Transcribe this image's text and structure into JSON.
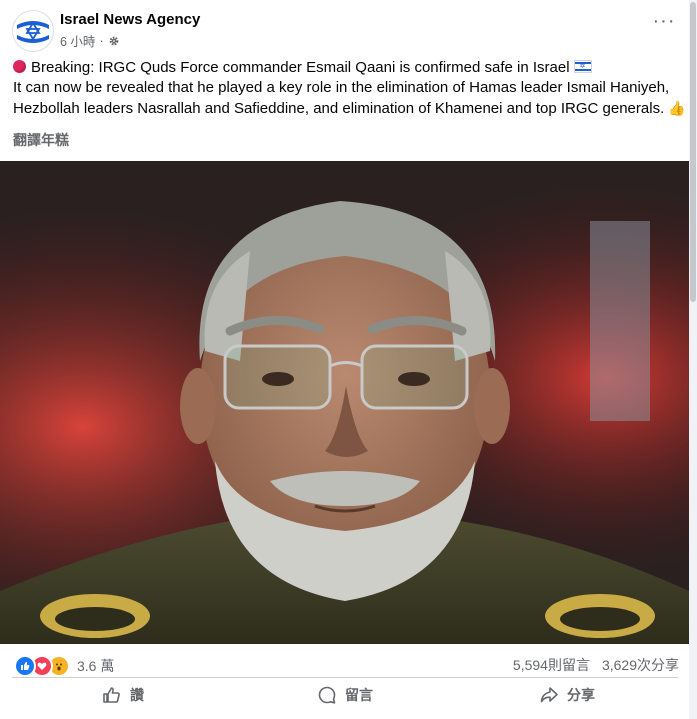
{
  "post": {
    "page_name": "Israel News Agency",
    "time": "6 小時",
    "line1": "Breaking: IRGC Quds Force commander Esmail Qaani is confirmed safe in Israel",
    "line2": "It can now be revealed that he played a key role in the elimination of Hamas leader Ismail Haniyeh,",
    "line3": "Hezbollah leaders Nasrallah and Safieddine, and elimination of Khamenei and top IRGC generals.",
    "translate_label": "翻譯年糕"
  },
  "engagement": {
    "reaction_count": "3.6 萬",
    "comments": "5,594則留言",
    "shares": "3,629次分享"
  },
  "actions": {
    "like": "讚",
    "comment": "留言",
    "share": "分享"
  },
  "icons": {
    "privacy": "settings-gear-icon",
    "more": "more-dots-icon",
    "reactions": [
      "like-icon",
      "love-icon",
      "wow-icon"
    ]
  },
  "colors": {
    "brand_blue": "#1877f2",
    "muted_text": "#65676b",
    "breaking_dot": "#e0245e"
  }
}
